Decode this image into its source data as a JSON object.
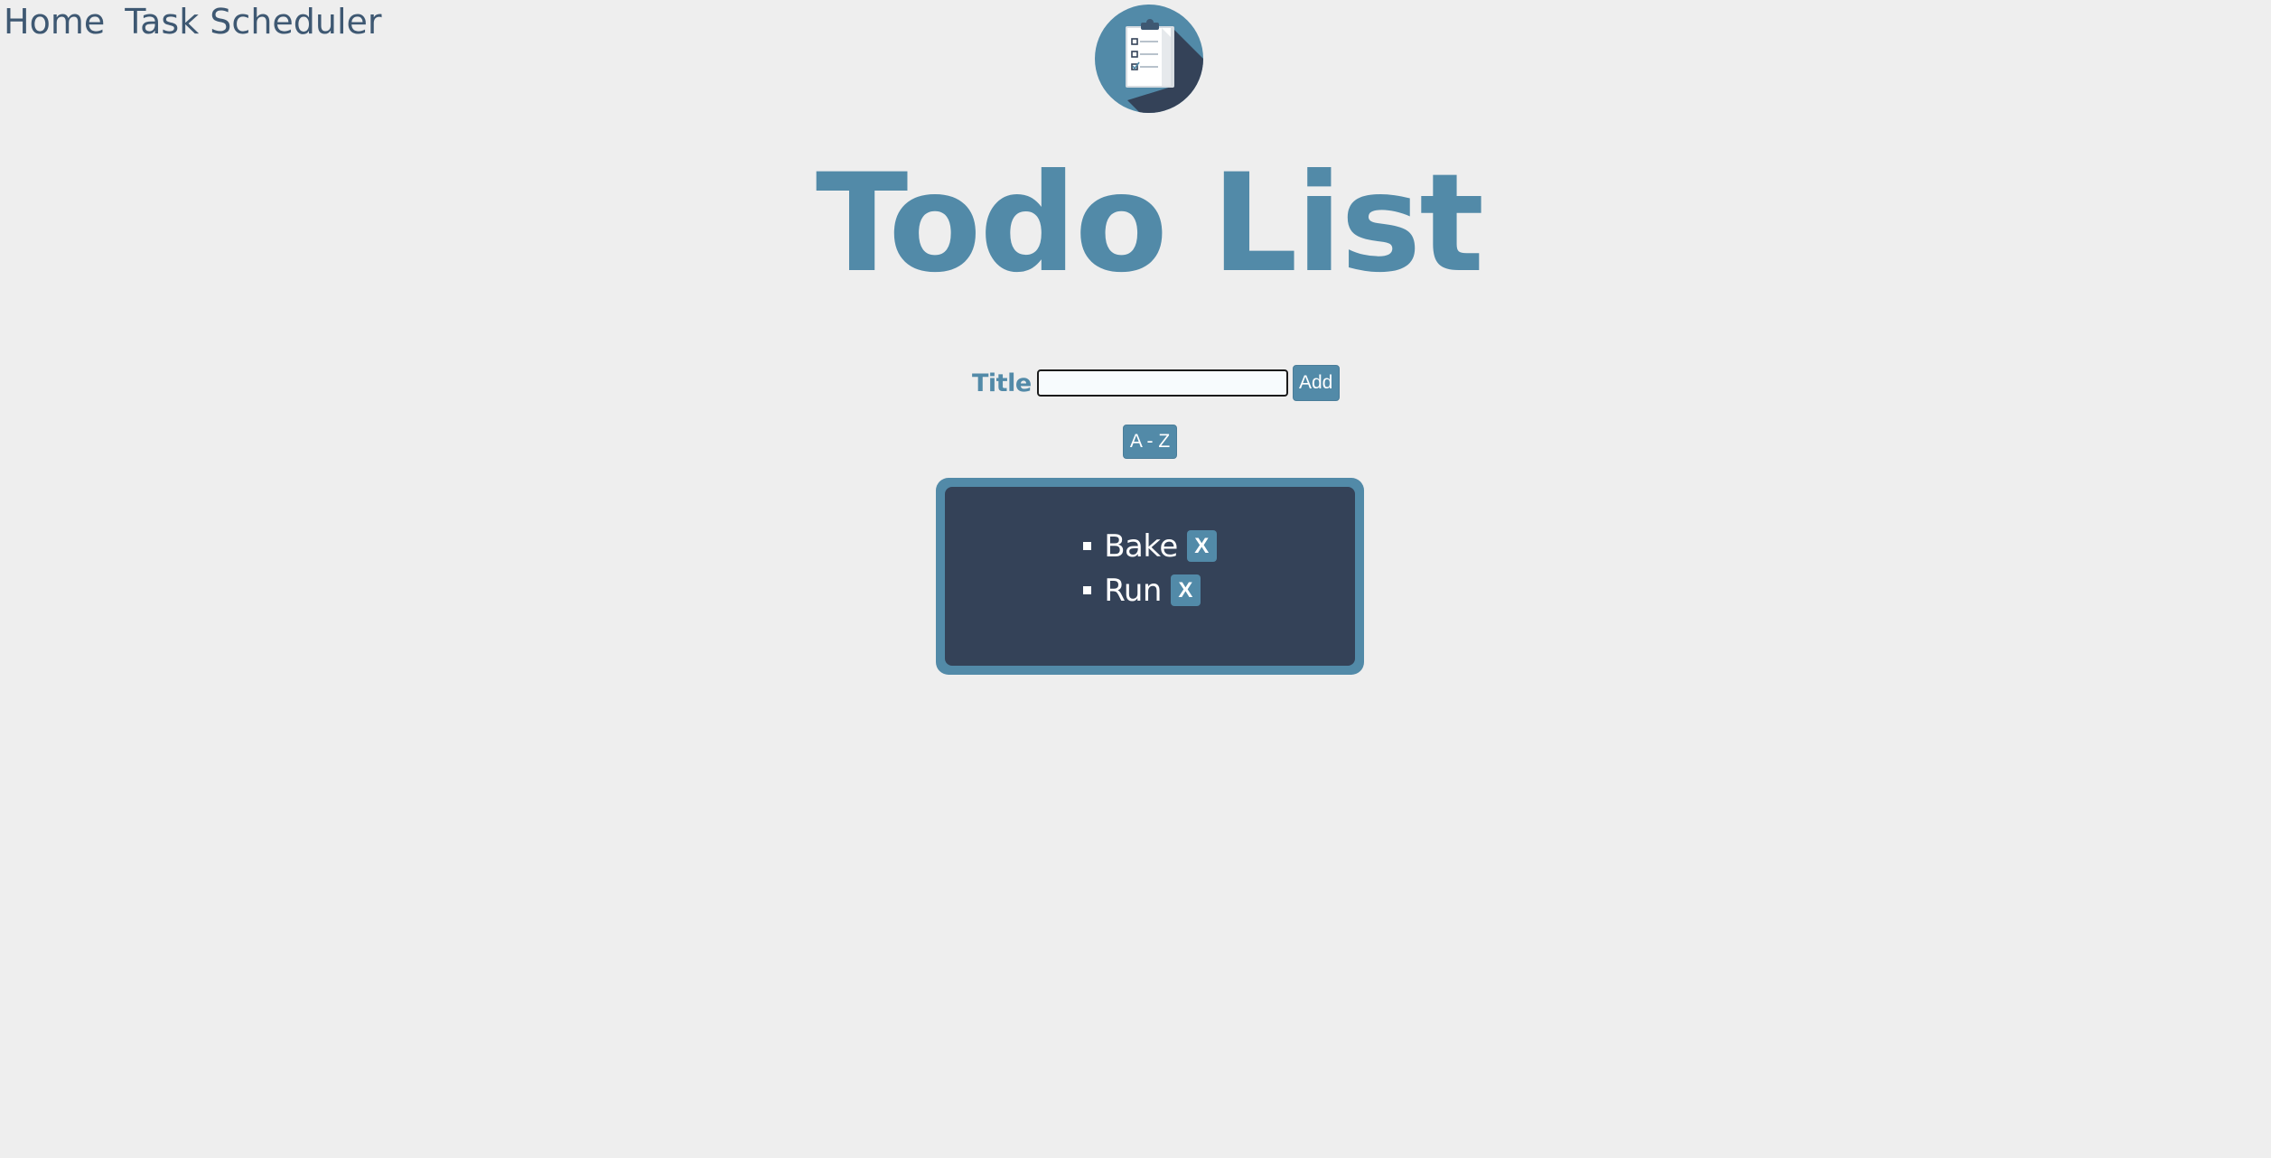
{
  "nav": {
    "items": [
      {
        "label": "Home"
      },
      {
        "label": "Task Scheduler"
      }
    ]
  },
  "header": {
    "logo_icon": "clipboard-checklist-icon",
    "title": "Todo List"
  },
  "form": {
    "label": "Title",
    "input_value": "",
    "input_placeholder": "",
    "add_label": "Add"
  },
  "sort": {
    "label": "A - Z"
  },
  "todos": [
    {
      "text": "Bake",
      "delete_label": "X"
    },
    {
      "text": "Run",
      "delete_label": "X"
    }
  ],
  "colors": {
    "background": "#eeeeee",
    "accent": "#528aa8",
    "panel": "#344258",
    "nav_text": "#3e5872"
  }
}
